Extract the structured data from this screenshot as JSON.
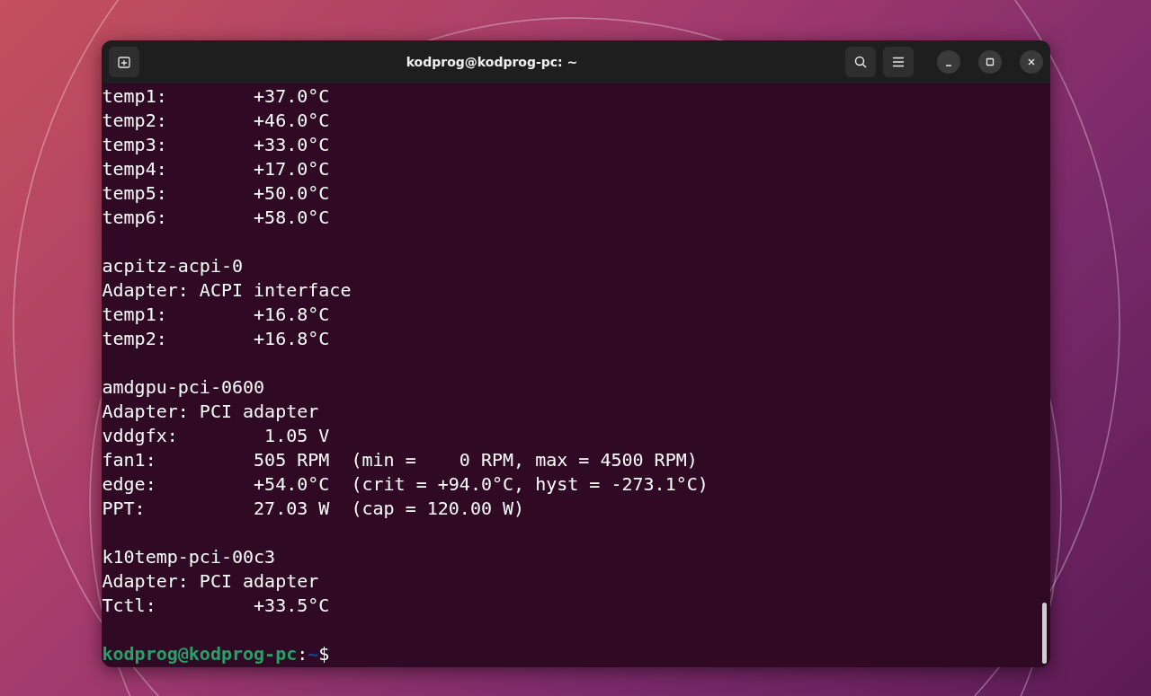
{
  "window": {
    "title": "kodprog@kodprog-pc: ~"
  },
  "output": [
    {
      "lines": [
        "temp1:        +37.0°C",
        "temp2:        +46.0°C",
        "temp3:        +33.0°C",
        "temp4:        +17.0°C",
        "temp5:        +50.0°C",
        "temp6:        +58.0°C"
      ]
    },
    {
      "lines": [
        "acpitz-acpi-0",
        "Adapter: ACPI interface",
        "temp1:        +16.8°C",
        "temp2:        +16.8°C"
      ]
    },
    {
      "lines": [
        "amdgpu-pci-0600",
        "Adapter: PCI adapter",
        "vddgfx:        1.05 V",
        "fan1:         505 RPM  (min =    0 RPM, max = 4500 RPM)",
        "edge:         +54.0°C  (crit = +94.0°C, hyst = -273.1°C)",
        "PPT:          27.03 W  (cap = 120.00 W)"
      ]
    },
    {
      "lines": [
        "k10temp-pci-00c3",
        "Adapter: PCI adapter",
        "Tctl:         +33.5°C"
      ]
    }
  ],
  "prompt": {
    "user_host": "kodprog@kodprog-pc",
    "separator": ":",
    "path": "~",
    "symbol": "$"
  }
}
